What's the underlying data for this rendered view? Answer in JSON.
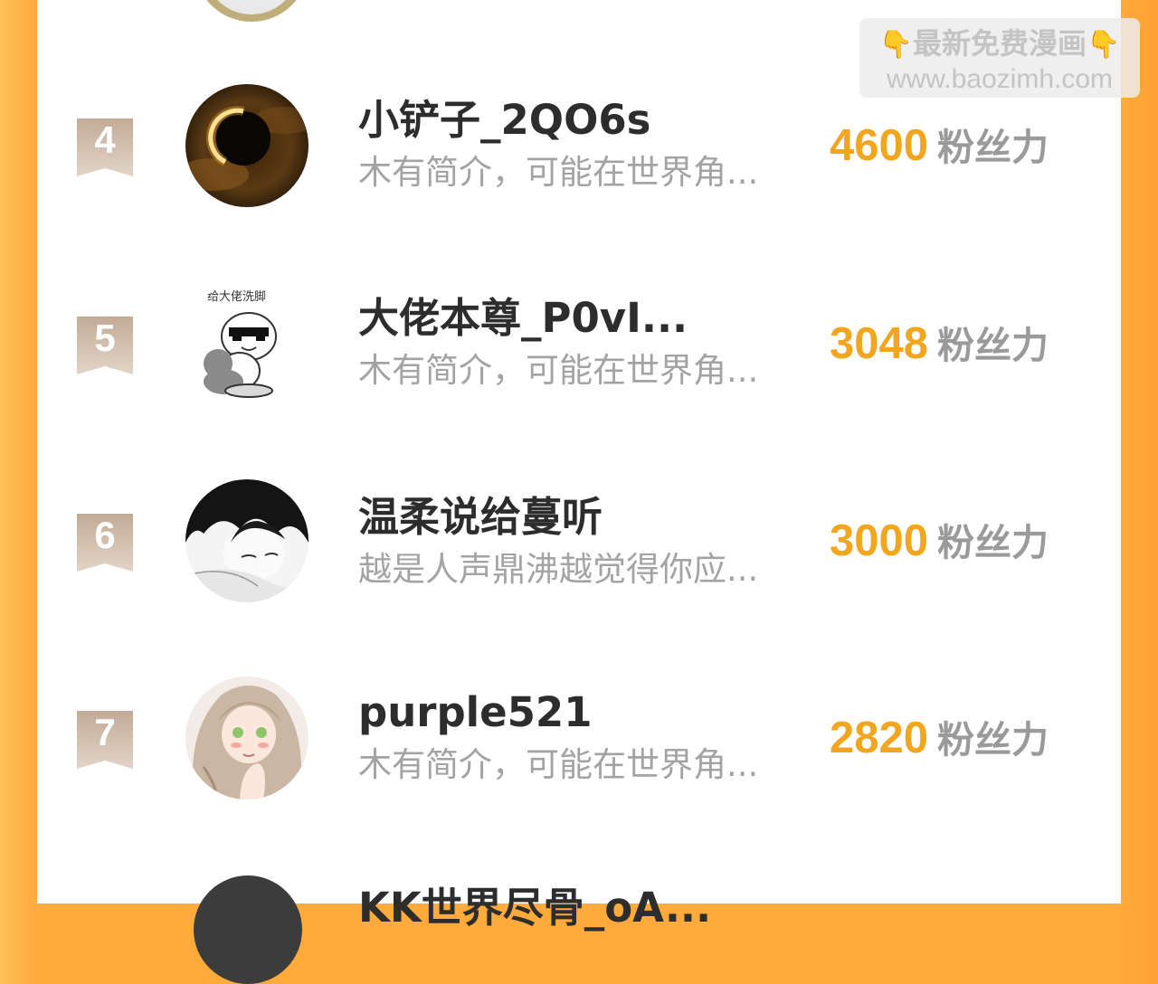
{
  "watermark": {
    "title": "最新免费漫画",
    "hand_icon": "👇",
    "url": "www.baozimh.com"
  },
  "colors": {
    "accent_orange": "#f2a51f",
    "frame_orange": "#ffab3c",
    "rank_badge": "#c9b3a0"
  },
  "ranking": [
    {
      "rank": "4",
      "name": "小铲子_2QO6s",
      "desc": "木有简介，可能在世界角...",
      "fans": "4600",
      "unit": "粉丝力",
      "avatar": "eclipse-avatar"
    },
    {
      "rank": "5",
      "name": "大佬本尊_P0vI...",
      "desc": "木有简介，可能在世界角...",
      "fans": "3048",
      "unit": "粉丝力",
      "avatar": "meme-avatar"
    },
    {
      "rank": "6",
      "name": "温柔说给蔓听",
      "desc": "越是人声鼎沸越觉得你应...",
      "fans": "3000",
      "unit": "粉丝力",
      "avatar": "manga-boy-avatar"
    },
    {
      "rank": "7",
      "name": "purple521",
      "desc": "木有简介，可能在世界角...",
      "fans": "2820",
      "unit": "粉丝力",
      "avatar": "anime-girl-avatar"
    }
  ],
  "partial_next": {
    "name": "KK世界尽骨_oA..."
  }
}
